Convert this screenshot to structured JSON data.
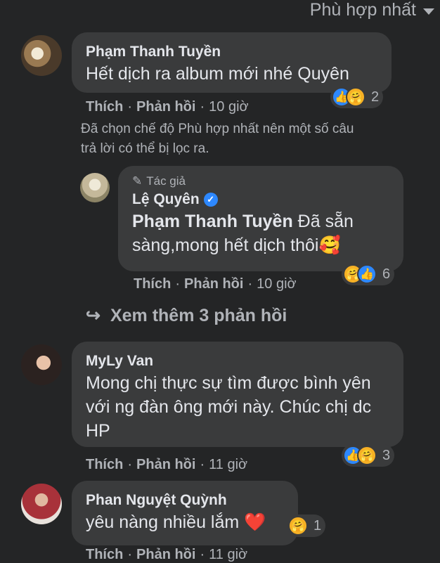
{
  "sort_label": "Phù hợp nhất",
  "filter_note": "Đã chọn chế độ Phù hợp nhất nên một số câu trả lời có thể bị lọc ra.",
  "more_replies": "Xem thêm 3 phản hồi",
  "like_label": "Thích",
  "reply_label": "Phản hồi",
  "comments": [
    {
      "name": "Phạm Thanh Tuyền",
      "text": "Hết dịch ra album mới nhé Quyên",
      "time": "10 giờ",
      "reactions": "2"
    },
    {
      "author_badge": "Tác giả",
      "name": "Lệ Quyên",
      "mention": "Phạm Thanh Tuyền",
      "text": " Đã sẵn sàng,mong hết dịch thôi🥰",
      "time": "10 giờ",
      "reactions": "6"
    },
    {
      "name": "MyLy Van",
      "text": "Mong chị thực sự tìm được bình yên với ng đàn ông mới này. Chúc chị dc HP",
      "time": "11 giờ",
      "reactions": "3"
    },
    {
      "name": "Phan Nguyệt Quỳnh",
      "text": "yêu nàng nhiều lắm ❤️",
      "time": "11 giờ",
      "reactions": "1"
    }
  ]
}
